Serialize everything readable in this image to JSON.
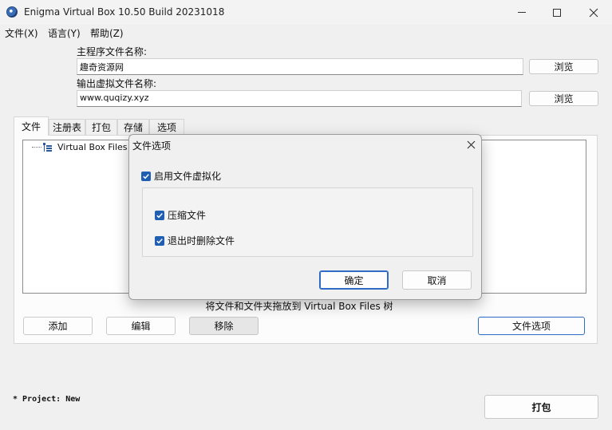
{
  "window": {
    "title": "Enigma Virtual Box 10.50 Build 20231018"
  },
  "menu": {
    "file": "文件(X)",
    "language": "语言(Y)",
    "help": "帮助(Z)"
  },
  "main_program": {
    "label": "主程序文件名称:",
    "value": "趣奇资源网",
    "browse": "浏览"
  },
  "output_file": {
    "label": "输出虚拟文件名称:",
    "value": "www.quqizy.xyz",
    "browse": "浏览"
  },
  "tabs": [
    "文件",
    "注册表",
    "打包",
    "存储",
    "选项"
  ],
  "tree": {
    "root": "Virtual Box Files"
  },
  "drag_hint": "将文件和文件夹拖放到 Virtual Box Files 树",
  "buttons": {
    "add": "添加",
    "edit": "编辑",
    "remove": "移除",
    "file_options": "文件选项",
    "pack": "打包"
  },
  "project_status": "* Project: New",
  "dialog": {
    "title": "文件选项",
    "enable_virtualization": {
      "label": "启用文件虚拟化",
      "checked": true
    },
    "compress": {
      "label": "压缩文件",
      "checked": true
    },
    "delete_on_exit": {
      "label": "退出时删除文件",
      "checked": true
    },
    "ok": "确定",
    "cancel": "取消"
  },
  "colors": {
    "checkbox_accent": "#1e5fb1",
    "focus_border": "#2e6bc5"
  }
}
